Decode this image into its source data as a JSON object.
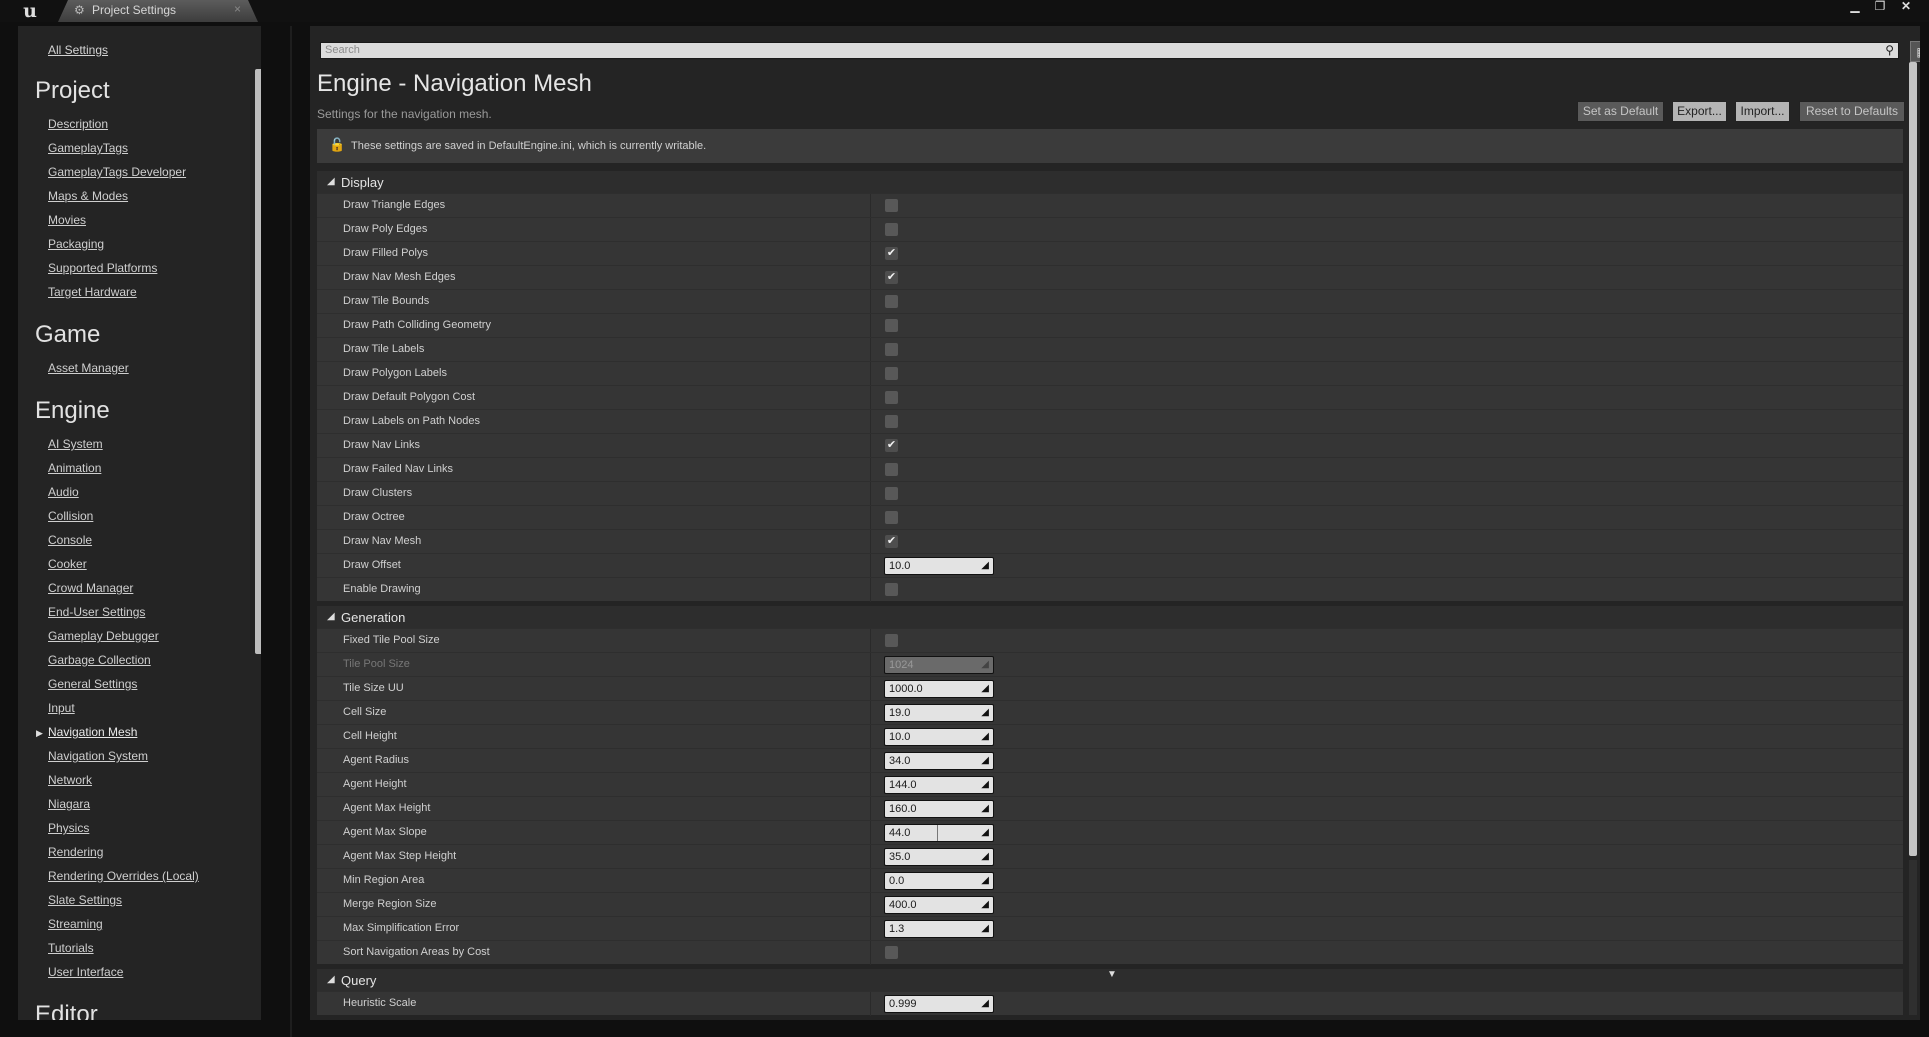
{
  "titlebar": {
    "tab_label": "Project Settings",
    "tab_icon": "gear-icon",
    "logo_text": "u",
    "close_glyph": "×",
    "window_buttons": [
      "minimize-icon",
      "restore-icon",
      "close-icon"
    ]
  },
  "sidebar": {
    "all_settings": "All Settings",
    "categories": [
      {
        "title": "Project",
        "items": [
          "Description",
          "GameplayTags",
          "GameplayTags Developer",
          "Maps & Modes",
          "Movies",
          "Packaging",
          "Supported Platforms",
          "Target Hardware"
        ]
      },
      {
        "title": "Game",
        "items": [
          "Asset Manager"
        ]
      },
      {
        "title": "Engine",
        "items": [
          "AI System",
          "Animation",
          "Audio",
          "Collision",
          "Console",
          "Cooker",
          "Crowd Manager",
          "End-User Settings",
          "Gameplay Debugger",
          "Garbage Collection",
          "General Settings",
          "Input",
          "Navigation Mesh",
          "Navigation System",
          "Network",
          "Niagara",
          "Physics",
          "Rendering",
          "Rendering Overrides (Local)",
          "Slate Settings",
          "Streaming",
          "Tutorials",
          "User Interface"
        ]
      },
      {
        "title": "Editor",
        "items": []
      }
    ],
    "active_item": "Navigation Mesh"
  },
  "search": {
    "placeholder": "Search"
  },
  "header": {
    "title": "Engine - Navigation Mesh",
    "subtitle": "Settings for the navigation mesh.",
    "buttons": {
      "set_default": "Set as Default",
      "export": "Export...",
      "import": "Import...",
      "reset": "Reset to Defaults"
    }
  },
  "notice": {
    "text": "These settings are saved in DefaultEngine.ini, which is currently writable."
  },
  "sections": [
    {
      "title": "Display",
      "rows": [
        {
          "name": "Draw Triangle Edges",
          "type": "checkbox",
          "checked": false
        },
        {
          "name": "Draw Poly Edges",
          "type": "checkbox",
          "checked": false
        },
        {
          "name": "Draw Filled Polys",
          "type": "checkbox",
          "checked": true
        },
        {
          "name": "Draw Nav Mesh Edges",
          "type": "checkbox",
          "checked": true
        },
        {
          "name": "Draw Tile Bounds",
          "type": "checkbox",
          "checked": false
        },
        {
          "name": "Draw Path Colliding Geometry",
          "type": "checkbox",
          "checked": false
        },
        {
          "name": "Draw Tile Labels",
          "type": "checkbox",
          "checked": false
        },
        {
          "name": "Draw Polygon Labels",
          "type": "checkbox",
          "checked": false
        },
        {
          "name": "Draw Default Polygon Cost",
          "type": "checkbox",
          "checked": false
        },
        {
          "name": "Draw Labels on Path Nodes",
          "type": "checkbox",
          "checked": false
        },
        {
          "name": "Draw Nav Links",
          "type": "checkbox",
          "checked": true
        },
        {
          "name": "Draw Failed Nav Links",
          "type": "checkbox",
          "checked": false
        },
        {
          "name": "Draw Clusters",
          "type": "checkbox",
          "checked": false
        },
        {
          "name": "Draw Octree",
          "type": "checkbox",
          "checked": false
        },
        {
          "name": "Draw Nav Mesh",
          "type": "checkbox",
          "checked": true
        },
        {
          "name": "Draw Offset",
          "type": "number",
          "value": "10.0"
        },
        {
          "name": "Enable Drawing",
          "type": "checkbox",
          "checked": false
        }
      ]
    },
    {
      "title": "Generation",
      "rows": [
        {
          "name": "Fixed Tile Pool Size",
          "type": "checkbox",
          "checked": false
        },
        {
          "name": "Tile Pool Size",
          "type": "number",
          "value": "1024",
          "disabled": true
        },
        {
          "name": "Tile Size UU",
          "type": "number",
          "value": "1000.0"
        },
        {
          "name": "Cell Size",
          "type": "number",
          "value": "19.0"
        },
        {
          "name": "Cell Height",
          "type": "number",
          "value": "10.0"
        },
        {
          "name": "Agent Radius",
          "type": "number",
          "value": "34.0"
        },
        {
          "name": "Agent Height",
          "type": "number",
          "value": "144.0"
        },
        {
          "name": "Agent Max Height",
          "type": "number",
          "value": "160.0"
        },
        {
          "name": "Agent Max Slope",
          "type": "number",
          "value": "44.0",
          "slider": true
        },
        {
          "name": "Agent Max Step Height",
          "type": "number",
          "value": "35.0"
        },
        {
          "name": "Min Region Area",
          "type": "number",
          "value": "0.0"
        },
        {
          "name": "Merge Region Size",
          "type": "number",
          "value": "400.0"
        },
        {
          "name": "Max Simplification Error",
          "type": "number",
          "value": "1.3"
        },
        {
          "name": "Sort Navigation Areas by Cost",
          "type": "checkbox",
          "checked": false
        }
      ]
    },
    {
      "title": "Query",
      "rows": [
        {
          "name": "Heuristic Scale",
          "type": "number",
          "value": "0.999"
        }
      ]
    }
  ],
  "colors": {
    "panel": "#242424",
    "row": "#353535",
    "section": "#2d2d2d",
    "field": "#e3e3e3"
  }
}
